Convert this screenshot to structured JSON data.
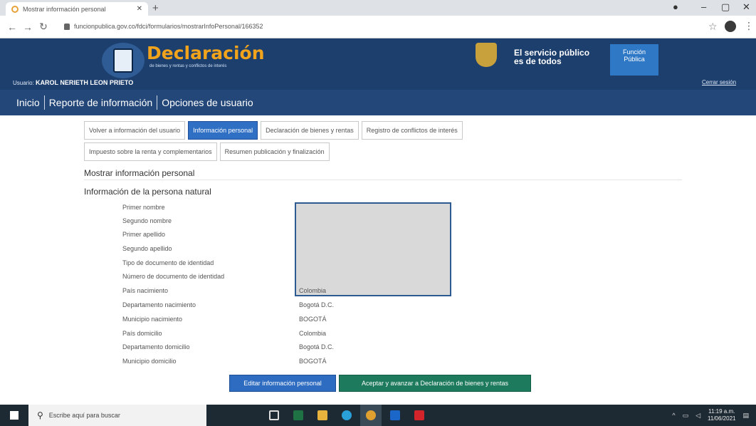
{
  "browser": {
    "tab_title": "Mostrar información personal",
    "url": "funcionpublica.gov.co/fdci/formularios/mostrarInfoPersonal/166352"
  },
  "header": {
    "brand_title": "Declaración",
    "brand_subtitle": "de bienes y rentas y conflictos de interés",
    "gov_line1": "El servicio público",
    "gov_line2": "es de todos",
    "fp_label_line1": "Función",
    "fp_label_line2": "Pública",
    "user_label": "Usuario:",
    "user_name": "KAROL NERIETH LEON PRIETO",
    "logout": "Cerrar sesión"
  },
  "mainnav": {
    "items": [
      "Inicio",
      "Reporte de información",
      "Opciones de usuario"
    ]
  },
  "subtabs": {
    "row1": [
      {
        "label": "Volver a información del usuario",
        "active": false
      },
      {
        "label": "Información personal",
        "active": true
      },
      {
        "label": "Declaración de bienes y rentas",
        "active": false
      },
      {
        "label": "Registro de conflictos de interés",
        "active": false
      }
    ],
    "row2": [
      {
        "label": "Impuesto sobre la renta y complementarios",
        "active": false
      },
      {
        "label": "Resumen publicación y finalización",
        "active": false
      }
    ]
  },
  "main": {
    "section_title": "Mostrar información personal",
    "subsection_title": "Información de la persona natural",
    "fields": [
      {
        "label": "Primer nombre",
        "value": ""
      },
      {
        "label": "Segundo nombre",
        "value": ""
      },
      {
        "label": "Primer apellido",
        "value": ""
      },
      {
        "label": "Segundo apellido",
        "value": ""
      },
      {
        "label": "Tipo de documento de identidad",
        "value": ""
      },
      {
        "label": "Número de documento de identidad",
        "value": ""
      },
      {
        "label": "País nacimiento",
        "value": "Colombia"
      },
      {
        "label": "Departamento nacimiento",
        "value": "Bogotá D.C."
      },
      {
        "label": "Municipio nacimiento",
        "value": "BOGOTÁ"
      },
      {
        "label": "País domicilio",
        "value": "Colombia"
      },
      {
        "label": "Departamento domicilio",
        "value": "Bogotá D.C."
      },
      {
        "label": "Municipio domicilio",
        "value": "BOGOTÁ"
      }
    ],
    "edit_button": "Editar información personal",
    "continue_button": "Aceptar y avanzar a Declaración de bienes y rentas"
  },
  "taskbar": {
    "search_placeholder": "Escribe aquí para buscar",
    "time": "11:19 a.m.",
    "date": "11/06/2021"
  },
  "colors": {
    "banner": "#1c3f6e",
    "nav": "#24477a",
    "brand_orange": "#f2a31c",
    "active_tab": "#2f6fc4",
    "success_button": "#1d7a5c"
  }
}
